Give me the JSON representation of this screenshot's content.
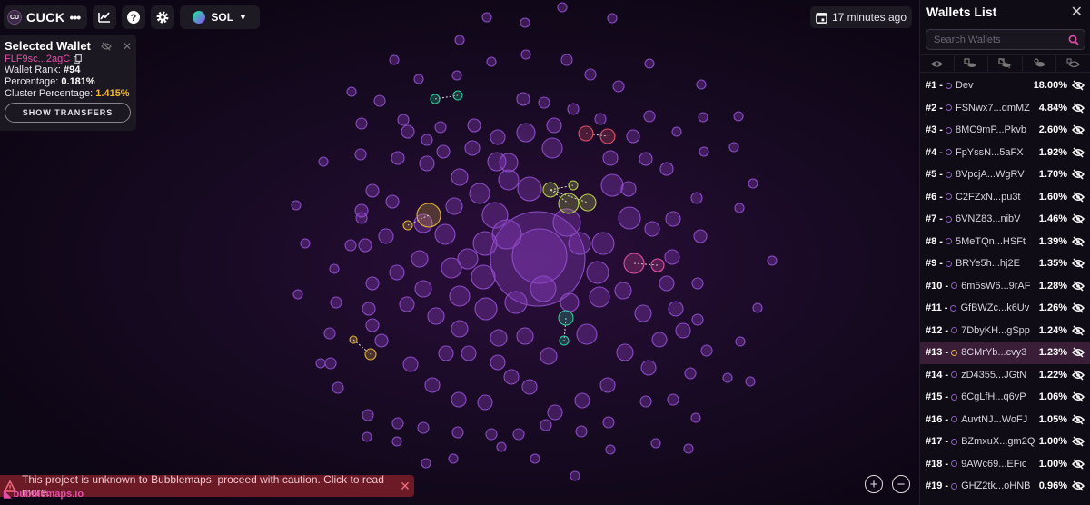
{
  "toolbar": {
    "token_logo": "CU",
    "token_name": "CUCK",
    "more": "•••",
    "chain": "SOL",
    "icons": [
      "chart-icon",
      "help-icon",
      "gear-icon"
    ]
  },
  "update": {
    "text": "17 minutes ago",
    "icon": "calendar-icon"
  },
  "selected_wallet": {
    "title": "Selected Wallet",
    "address": "FLF9sc...2agC",
    "rank_label": "Wallet Rank:",
    "rank_value": "#94",
    "pct_label": "Percentage:",
    "pct_value": "0.181%",
    "cluster_label": "Cluster Percentage:",
    "cluster_value": "1.415%",
    "button": "SHOW TRANSFERS"
  },
  "warning": {
    "text": "This project is unknown to Bubblemaps, proceed with caution. Click to read more."
  },
  "brand": {
    "text": "bubblemaps.io"
  },
  "zoom": {
    "in": "+",
    "out": "−"
  },
  "sidebar": {
    "title": "Wallets List",
    "search_placeholder": "Search Wallets",
    "wallets": [
      {
        "rank": "#1 -",
        "name": "Dev",
        "pct": "18.00%"
      },
      {
        "rank": "#2 -",
        "name": "FSNwx7...dmMZ",
        "pct": "4.84%"
      },
      {
        "rank": "#3 -",
        "name": "8MC9mP...Pkvb",
        "pct": "2.60%"
      },
      {
        "rank": "#4 -",
        "name": "FpYssN...5aFX",
        "pct": "1.92%"
      },
      {
        "rank": "#5 -",
        "name": "8VpcjA...WgRV",
        "pct": "1.70%"
      },
      {
        "rank": "#6 -",
        "name": "C2FZxN...pu3t",
        "pct": "1.60%"
      },
      {
        "rank": "#7 -",
        "name": "6VNZ83...nibV",
        "pct": "1.46%"
      },
      {
        "rank": "#8 -",
        "name": "5MeTQn...HSFt",
        "pct": "1.39%"
      },
      {
        "rank": "#9 -",
        "name": "BRYe5h...hj2E",
        "pct": "1.35%"
      },
      {
        "rank": "#10 -",
        "name": "6m5sW6...9rAF",
        "pct": "1.28%"
      },
      {
        "rank": "#11 -",
        "name": "GfBWZc...k6Uv",
        "pct": "1.26%"
      },
      {
        "rank": "#12 -",
        "name": "7DbyKH...gSpp",
        "pct": "1.24%"
      },
      {
        "rank": "#13 -",
        "name": "8CMrYb...cvy3",
        "pct": "1.23%",
        "selected": true
      },
      {
        "rank": "#14 -",
        "name": "zD4355...JGtN",
        "pct": "1.22%"
      },
      {
        "rank": "#15 -",
        "name": "6CgLfH...q6vP",
        "pct": "1.06%"
      },
      {
        "rank": "#16 -",
        "name": "AuvtNJ...WoFJ",
        "pct": "1.05%"
      },
      {
        "rank": "#17 -",
        "name": "BZmxuX...gm2Q",
        "pct": "1.00%"
      },
      {
        "rank": "#18 -",
        "name": "9AWc69...EFic",
        "pct": "1.00%"
      },
      {
        "rank": "#19 -",
        "name": "GHZ2tk...oHNB",
        "pct": "0.96%"
      }
    ]
  },
  "colors": {
    "accent": "#e24ea8",
    "bubble": "#8c3fc2",
    "cluster_green": "#2ec89a",
    "cluster_yellow": "#e0b23a",
    "cluster_red": "#e0506a",
    "cluster_lime": "#b6d04a",
    "selected_row": "#3a1d36"
  }
}
